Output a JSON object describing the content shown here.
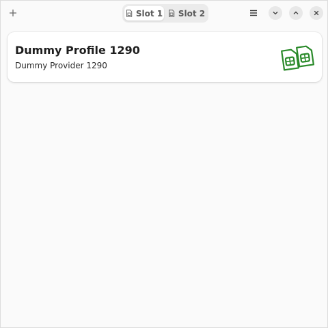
{
  "header": {
    "add_icon": "plus-icon",
    "tabs": [
      {
        "label": "Slot 1",
        "icon": "sim-card-icon",
        "active": true
      },
      {
        "label": "Slot 2",
        "icon": "sim-card-icon",
        "active": false
      }
    ],
    "menu_icon": "hamburger-menu-icon",
    "window_controls": [
      "minimize-icon",
      "maximize-icon",
      "close-icon"
    ]
  },
  "profile": {
    "name": "Dummy Profile 1290",
    "provider": "Dummy Provider 1290",
    "icon": "dual-sim-cards-icon",
    "icon_color": "#2a8a2a"
  }
}
